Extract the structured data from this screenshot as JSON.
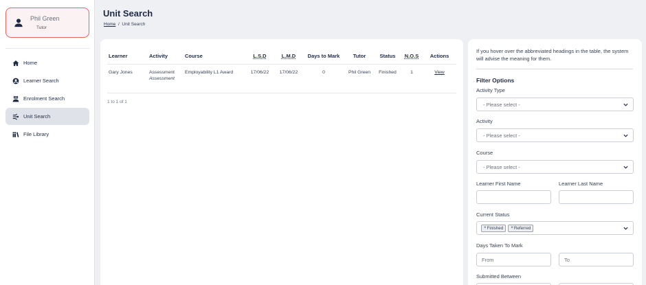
{
  "user": {
    "name": "Phil Green",
    "role": "Tutor"
  },
  "nav": [
    {
      "label": "Home",
      "icon": "home-icon",
      "active": false
    },
    {
      "label": "Learner Search",
      "icon": "user-circle-icon",
      "active": false
    },
    {
      "label": "Enrolment Search",
      "icon": "graduation-icon",
      "active": false
    },
    {
      "label": "Unit Search",
      "icon": "unit-icon",
      "active": true
    },
    {
      "label": "File Library",
      "icon": "library-icon",
      "active": false
    }
  ],
  "header": {
    "title": "Unit Search",
    "breadcrumb": {
      "home": "Home",
      "separator": "/",
      "current": "Unit Search"
    }
  },
  "table": {
    "headers": {
      "learner": "Learner",
      "activity": "Activity",
      "course": "Course",
      "lsd": "L.S.D",
      "lmd": "L.M.D",
      "days": "Days to Mark",
      "tutor": "Tutor",
      "status": "Status",
      "nos": "N.O.S",
      "actions": "Actions"
    },
    "rows": [
      {
        "learner": "Gary Jones",
        "activity": "Assessment",
        "activity_sub": "Assessment",
        "course": "Employability L1 Award",
        "lsd": "17/06/22",
        "lmd": "17/06/22",
        "days": "0",
        "tutor": "Phil Green",
        "status": "Finished",
        "nos": "1",
        "action": "View"
      }
    ],
    "pager": "1 to 1 of 1"
  },
  "filters": {
    "info": "If you hover over the abbreviated headings in the table, the system will advise the meaning for them.",
    "title": "Filter Options",
    "activity_type": {
      "label": "Activity Type",
      "value": "- Please select -"
    },
    "activity": {
      "label": "Activity",
      "value": "- Please select -"
    },
    "course": {
      "label": "Course",
      "value": "- Please select -"
    },
    "learner_first": {
      "label": "Learner First Name",
      "value": ""
    },
    "learner_last": {
      "label": "Learner Last Name",
      "value": ""
    },
    "status": {
      "label": "Current Status",
      "tags": [
        "Finished",
        "Referred"
      ]
    },
    "days_taken": {
      "label": "Days Taken To Mark",
      "from_placeholder": "From",
      "to_placeholder": "To"
    },
    "submitted": {
      "label": "Submitted Between"
    }
  }
}
